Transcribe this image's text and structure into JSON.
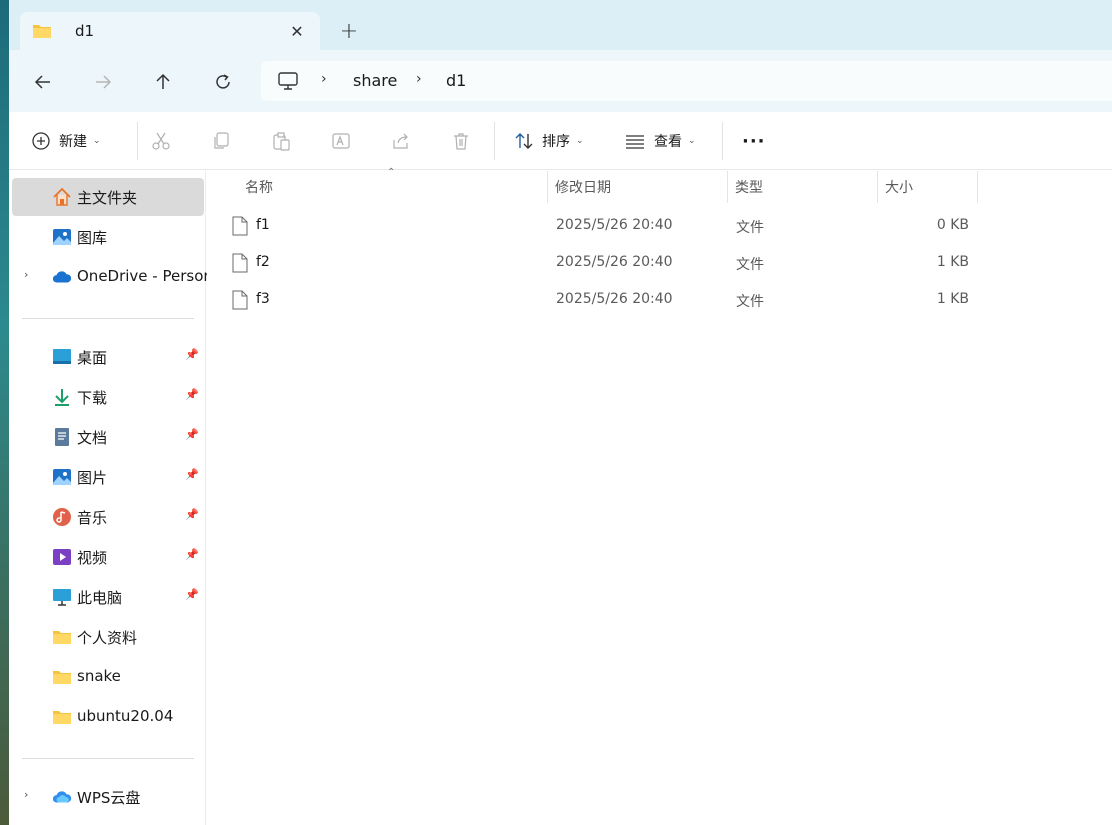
{
  "tab": {
    "title": "d1",
    "close_glyph": "✕",
    "new_tab_glyph": "+"
  },
  "nav": {
    "back_icon": "arrow-left-icon",
    "forward_icon": "arrow-right-icon",
    "up_icon": "arrow-up-icon",
    "refresh_icon": "refresh-icon"
  },
  "address": {
    "root_icon": "this-pc-icon",
    "crumbs": [
      "share",
      "d1"
    ],
    "separator": "›"
  },
  "toolbar": {
    "new_label": "新建",
    "sort_label": "排序",
    "view_label": "查看",
    "more_label": "···"
  },
  "sidebar": {
    "items": [
      {
        "label": "主文件夹",
        "icon": "home-icon"
      },
      {
        "label": "图库",
        "icon": "gallery-icon"
      },
      {
        "label": "OneDrive - Persor",
        "icon": "onedrive-icon"
      },
      {
        "label": "桌面",
        "icon": "desktop-icon"
      },
      {
        "label": "下载",
        "icon": "download-icon"
      },
      {
        "label": "文档",
        "icon": "documents-icon"
      },
      {
        "label": "图片",
        "icon": "pictures-icon"
      },
      {
        "label": "音乐",
        "icon": "music-icon"
      },
      {
        "label": "视频",
        "icon": "videos-icon"
      },
      {
        "label": "此电脑",
        "icon": "this-pc-icon"
      },
      {
        "label": "个人资料",
        "icon": "folder-icon"
      },
      {
        "label": "snake",
        "icon": "folder-icon"
      },
      {
        "label": "ubuntu20.04",
        "icon": "folder-icon"
      },
      {
        "label": "WPS云盘",
        "icon": "cloud-icon"
      }
    ]
  },
  "columns": {
    "name": "名称",
    "date": "修改日期",
    "type": "类型",
    "size": "大小"
  },
  "files": [
    {
      "name": "f1",
      "date": "2025/5/26 20:40",
      "type": "文件",
      "size": "0 KB"
    },
    {
      "name": "f2",
      "date": "2025/5/26 20:40",
      "type": "文件",
      "size": "1 KB"
    },
    {
      "name": "f3",
      "date": "2025/5/26 20:40",
      "type": "文件",
      "size": "1 KB"
    }
  ],
  "colors": {
    "accent": "#0067c0",
    "tab_strip": "#dceff6",
    "nav_bg": "#edf7fb",
    "folder": "#f5c343"
  }
}
